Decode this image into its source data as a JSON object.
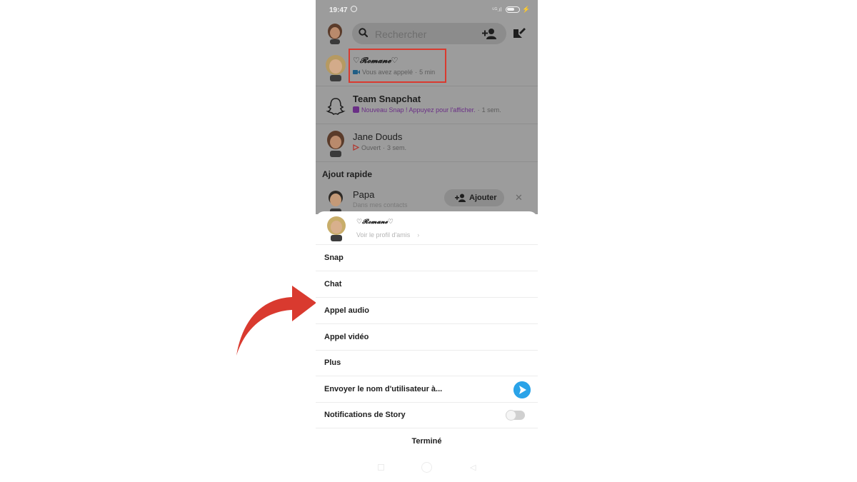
{
  "status_bar": {
    "time": "19:47",
    "signal": "⁵ᴳ.ıl"
  },
  "search": {
    "placeholder": "Rechercher"
  },
  "chats": [
    {
      "name": "♡𝓡𝓸𝓶𝓪𝓷𝓮♡",
      "status": "Vous avez appelé",
      "time": "5 min"
    },
    {
      "name": "Team Snapchat",
      "status": "Nouveau Snap ! Appuyez pour l'afficher.",
      "time": "1 sem."
    },
    {
      "name": "Jane Douds",
      "status": "Ouvert",
      "time": "3 sem."
    }
  ],
  "quick_add": {
    "title": "Ajout rapide",
    "items": [
      {
        "name": "Papa",
        "subtitle": "Dans mes contacts",
        "add_label": "Ajouter"
      }
    ]
  },
  "sheet": {
    "name": "♡𝓡𝓸𝓶𝓪𝓷𝓮♡",
    "profile_link": "Voir le profil d'amis",
    "options": [
      {
        "label": "Snap"
      },
      {
        "label": "Chat"
      },
      {
        "label": "Appel audio"
      },
      {
        "label": "Appel vidéo"
      },
      {
        "label": "Plus"
      },
      {
        "label": "Envoyer le nom d'utilisateur à..."
      },
      {
        "label": "Notifications de Story"
      }
    ],
    "done_label": "Terminé"
  },
  "colors": {
    "highlight": "#d93a2f",
    "arrow": "#d93a2f",
    "send_button": "#2aa3e8",
    "snap_purple": "#6a2f86",
    "dim_overlay": "#9c9c9c"
  },
  "icons": [
    "alarm-icon",
    "battery-icon",
    "search-icon",
    "add-friend-icon",
    "new-chat-icon",
    "ghost-icon",
    "video-call-icon",
    "snap-square-icon",
    "opened-arrow-icon",
    "close-icon",
    "send-icon",
    "toggle-switch"
  ]
}
